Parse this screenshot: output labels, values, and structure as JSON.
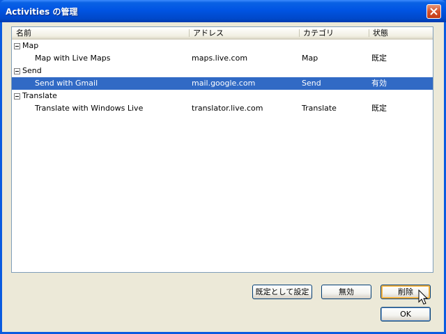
{
  "window": {
    "title": "Activities の管理"
  },
  "list": {
    "columns": [
      "名前",
      "アドレス",
      "カテゴリ",
      "状態"
    ],
    "groups": [
      {
        "name": "Map",
        "items": [
          {
            "name": "Map with Live Maps",
            "address": "maps.live.com",
            "category": "Map",
            "status": "既定",
            "selected": false
          }
        ]
      },
      {
        "name": "Send",
        "items": [
          {
            "name": "Send with Gmail",
            "address": "mail.google.com",
            "category": "Send",
            "status": "有効",
            "selected": true
          }
        ]
      },
      {
        "name": "Translate",
        "items": [
          {
            "name": "Translate with Windows Live",
            "address": "translator.live.com",
            "category": "Translate",
            "status": "既定",
            "selected": false
          }
        ]
      }
    ]
  },
  "buttons": {
    "set_default": "既定として設定",
    "disable": "無効",
    "delete": "削除",
    "ok": "OK"
  },
  "colors": {
    "title_bar": "#0054e3",
    "selection": "#316ac5",
    "dialog_bg": "#ece9d8"
  }
}
